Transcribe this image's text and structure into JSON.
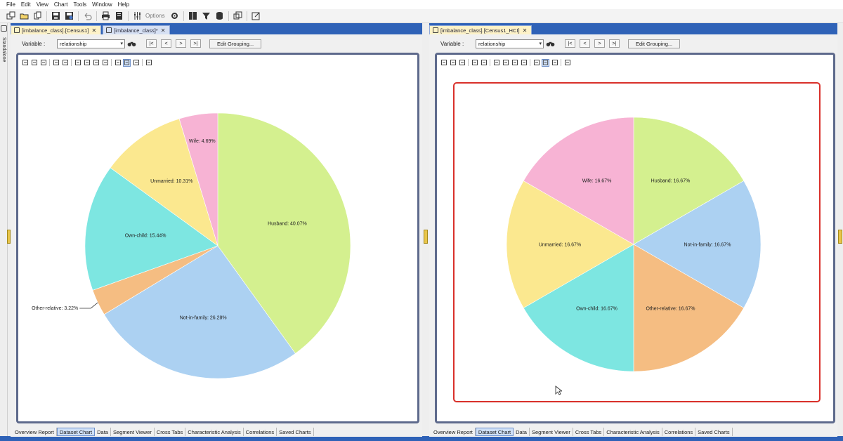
{
  "menu": [
    "File",
    "Edit",
    "View",
    "Chart",
    "Tools",
    "Window",
    "Help"
  ],
  "toolbar": {
    "options_label": "Options",
    "icons": [
      "new-window-icon",
      "open-folder-icon",
      "copy-icon",
      "save-icon",
      "save-as-icon",
      "undo-icon",
      "print-icon",
      "report-icon",
      "sliders-icon",
      "gear-icon",
      "table-icon",
      "filter-icon",
      "database-icon",
      "windows-icon",
      "export-icon"
    ]
  },
  "sidebar": {
    "label": "Standalone"
  },
  "left_panel": {
    "tabs": [
      {
        "label": "[imbalance_class].[Census1]",
        "active": true
      },
      {
        "label": "[imbalance_class]*",
        "active": false
      }
    ],
    "variable_label": "Variable :",
    "variable_value": "relationship",
    "nav": [
      "|<",
      "<",
      ">",
      ">|"
    ],
    "edit_grouping": "Edit Grouping...",
    "bottom_tabs": [
      "Overview Report",
      "Dataset Chart",
      "Data",
      "Segment Viewer",
      "Cross Tabs",
      "Characteristic Analysis",
      "Correlations",
      "Saved Charts"
    ],
    "active_bottom_tab": "Dataset Chart"
  },
  "right_panel": {
    "tabs": [
      {
        "label": "[imbalance_class].[Census1_HCI]",
        "active": true
      }
    ],
    "variable_label": "Variable :",
    "variable_value": "relationship",
    "nav": [
      "|<",
      "<",
      ">",
      ">|"
    ],
    "edit_grouping": "Edit Grouping...",
    "bottom_tabs": [
      "Overview Report",
      "Dataset Chart",
      "Data",
      "Segment Viewer",
      "Cross Tabs",
      "Characteristic Analysis",
      "Correlations",
      "Saved Charts"
    ],
    "active_bottom_tab": "Dataset Chart"
  },
  "colors": {
    "Husband": "#d4f08f",
    "Not-in-family": "#acd1f2",
    "Other-relative": "#f5bd82",
    "Own-child": "#7de6e1",
    "Unmarried": "#fbe88f",
    "Wife": "#f7b3d4",
    "workspace": "#2f62b7",
    "highlight_frame": "#d9302a"
  },
  "chart_data": [
    {
      "type": "pie",
      "title": "",
      "labels": [
        "Husband",
        "Not-in-family",
        "Other-relative",
        "Own-child",
        "Unmarried",
        "Wife"
      ],
      "values": [
        40.07,
        26.28,
        3.22,
        15.44,
        10.31,
        4.69
      ],
      "slice_labels": [
        "Husband: 40.07%",
        "Not-in-family: 26.28%",
        "Other-relative: 3.22%",
        "Own-child: 15.44%",
        "Unmarried: 10.31%",
        "Wife: 4.69%"
      ],
      "start": "12 o'clock, clockwise"
    },
    {
      "type": "pie",
      "title": "",
      "labels": [
        "Husband",
        "Not-in-family",
        "Other-relative",
        "Own-child",
        "Unmarried",
        "Wife"
      ],
      "values": [
        16.67,
        16.67,
        16.67,
        16.67,
        16.67,
        16.67
      ],
      "slice_labels": [
        "Husband: 16.67%",
        "Not-in-family: 16.67%",
        "Other-relative: 16.67%",
        "Own-child: 16.67%",
        "Unmarried: 16.67%",
        "Wife: 16.67%"
      ],
      "start": "12 o'clock, clockwise"
    }
  ]
}
